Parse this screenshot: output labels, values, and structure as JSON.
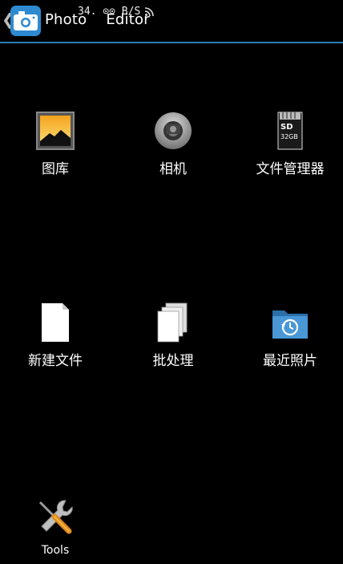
{
  "action_bar": {
    "title_part1": "Photo",
    "title_part2": "Editor",
    "status_overlay": "34. ⊙⊙ B/S",
    "accent_color": "#2c7fb8"
  },
  "grid": {
    "items": [
      {
        "label": "图库",
        "icon": "gallery-icon"
      },
      {
        "label": "相机",
        "icon": "camera-icon"
      },
      {
        "label": "文件管理器",
        "icon": "sd-card-icon"
      },
      {
        "label": "新建文件",
        "icon": "new-file-icon"
      },
      {
        "label": "批处理",
        "icon": "batch-icon"
      },
      {
        "label": "最近照片",
        "icon": "recent-folder-icon"
      },
      {
        "label": "Tools",
        "icon": "tools-icon"
      }
    ]
  },
  "sd_card": {
    "title": "SD",
    "capacity": "32GB"
  }
}
